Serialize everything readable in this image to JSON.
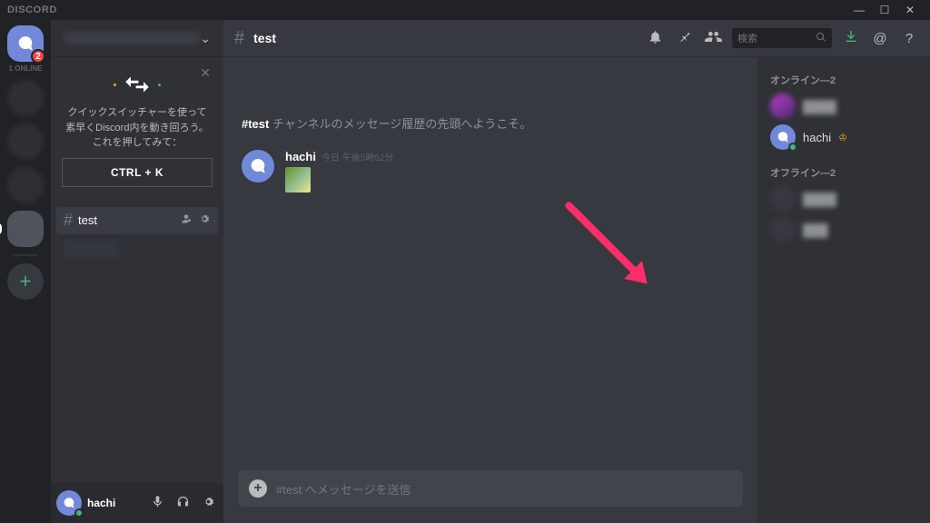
{
  "app_name": "DISCORD",
  "home_badge": "2",
  "online_label": "1 ONLINE",
  "quick_switcher": {
    "line1": "クイックスイッチャーを使って",
    "line2": "素早くDiscord内を動き回ろう。",
    "line3": "これを押してみて：",
    "button": "CTRL + K"
  },
  "channel": {
    "name": "test",
    "hash": "#"
  },
  "topbar": {
    "search_placeholder": "検索"
  },
  "welcome": {
    "prefix": "#test",
    "text": " チャンネルのメッセージ履歴の先頭へようこそ。"
  },
  "message": {
    "author": "hachi",
    "timestamp": "今日 午後5時52分"
  },
  "composer": {
    "placeholder": "#test へメッセージを送信"
  },
  "members": {
    "online_header": "オンライン—2",
    "offline_header": "オフライン—2",
    "user1": "hachi"
  },
  "me": {
    "name": "hachi"
  }
}
